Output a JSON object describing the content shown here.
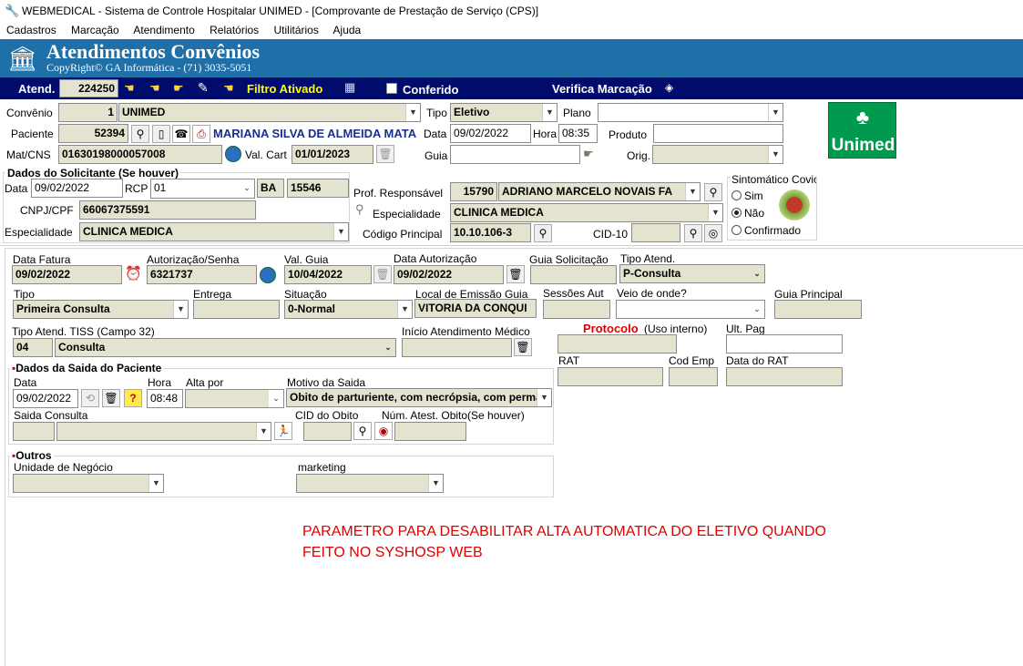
{
  "window": {
    "title": "WEBMEDICAL - Sistema de Controle Hospitalar UNIMED - [Comprovante de Prestação de Serviço  (CPS)]"
  },
  "menu": [
    "Cadastros",
    "Marcação",
    "Atendimento",
    "Relatórios",
    "Utilitários",
    "Ajuda"
  ],
  "banner": {
    "title": "Atendimentos Convênios",
    "subtitle": "CopyRight© GA Informática - (71) 3035-5051",
    "bg": "#1f6fa8"
  },
  "toolbar": {
    "atend_label": "Atend.",
    "atend_value": "224250",
    "filtro": "Filtro Ativado",
    "conferido": "Conferido",
    "verifica": "Verifica Marcação",
    "bg": "#000c6b",
    "filtro_color": "#ffff00"
  },
  "top": {
    "convenio_label": "Convênio",
    "convenio_code": "1",
    "convenio_name": "UNIMED",
    "tipo_label": "Tipo",
    "tipo_value": "Eletivo",
    "plano_label": "Plano",
    "plano_value": "",
    "paciente_label": "Paciente",
    "paciente_code": "52394",
    "paciente_name": "MARIANA SILVA DE ALMEIDA MATA",
    "data_label": "Data",
    "data_value": "09/02/2022",
    "hora_label": "Hora",
    "hora_value": "08:35",
    "produto_label": "Produto",
    "produto_value": "",
    "matcns_label": "Mat/CNS",
    "matcns_value": "01630198000057008",
    "valcart_label": "Val. Cart",
    "valcart_value": "01/01/2023",
    "guia_label": "Guia",
    "guia_value": "",
    "orig_label": "Orig.",
    "orig_value": "",
    "logo_text": "Unimed"
  },
  "solicitante": {
    "title": "Dados do Solicitante (Se houver)",
    "data_label": "Data",
    "data_value": "09/02/2022",
    "rcp_label": "RCP",
    "rcp_value": "01",
    "uf": "BA",
    "crm": "15546",
    "cnpj_label": "CNPJ/CPF",
    "cnpj_value": "66067375591",
    "esp_label": "Especialidade",
    "esp_value": "CLINICA MEDICA"
  },
  "profissional": {
    "label": "Prof. Responsável",
    "code": "15790",
    "name": "ADRIANO MARCELO NOVAIS FA",
    "esp_label": "Especialidade",
    "esp_value": "CLINICA MEDICA",
    "cod_label": "Código Principal",
    "cod_value": "10.10.106-3",
    "cid_label": "CID-10",
    "cid_value": ""
  },
  "sintomatico": {
    "label": "Sintomático Covic",
    "options": [
      "Sim",
      "Não",
      "Confirmado"
    ],
    "selected": "Não"
  },
  "fatura": {
    "data_fatura_label": "Data Fatura",
    "data_fatura": "09/02/2022",
    "aut_label": "Autorização/Senha",
    "aut_value": "6321737",
    "val_guia_label": "Val. Guia",
    "val_guia": "10/04/2022",
    "data_aut_label": "Data Autorização",
    "data_aut": "09/02/2022",
    "guia_sol_label": "Guia Solicitação",
    "guia_sol": "",
    "tipo_atend_label": "Tipo Atend.",
    "tipo_atend": "P-Consulta",
    "tipo_label": "Tipo",
    "tipo_value": "Primeira Consulta",
    "entrega_label": "Entrega",
    "entrega_value": "",
    "situacao_label": "Situação",
    "situacao_value": "0-Normal",
    "local_label": "Local de Emissão Guia",
    "local_value": "VITORIA DA CONQUI",
    "sessoes_label": "Sessões Aut",
    "sessoes_value": "",
    "veio_label": "Veio de onde?",
    "veio_value": "",
    "guia_principal_label": "Guia Principal",
    "guia_principal": "",
    "tiss_label": "Tipo Atend. TISS (Campo 32)",
    "tiss_code": "04",
    "tiss_value": "Consulta",
    "inicio_label": "Início Atendimento Médico",
    "inicio_value": "",
    "protocolo_label": "Protocolo",
    "protocolo_note": "(Uso interno)",
    "protocolo_value": "",
    "ult_pag_label": "Ult. Pag",
    "ult_pag": "",
    "rat_label": "RAT",
    "rat": "",
    "cod_emp_label": "Cod Emp",
    "cod_emp": "",
    "data_rat_label": "Data do RAT",
    "data_rat": ""
  },
  "saida": {
    "title": "Dados da Saida do Paciente",
    "data_label": "Data",
    "data_value": "09/02/2022",
    "hora_label": "Hora",
    "hora_value": "08:48",
    "alta_label": "Alta por",
    "alta_value": "",
    "motivo_label": "Motivo da Saida",
    "motivo_value": "Obito de parturiente, com necrópsia, com perma",
    "consulta_label": "Saida Consulta",
    "consulta_code": "",
    "consulta_value": "",
    "cid_obito_label": "CID do Obito",
    "cid_obito": "",
    "atest_label": "Núm. Atest. Obito(Se houver)",
    "atest_value": ""
  },
  "outros": {
    "title": "Outros",
    "unidade_label": "Unidade de Negócio",
    "unidade_value": "",
    "marketing_label": "marketing",
    "marketing_value": ""
  },
  "note": {
    "line1": "PARAMETRO PARA DESABILITAR ALTA AUTOMATICA DO ELETIVO QUANDO",
    "line2": "FEITO NO SYSHOSP WEB",
    "color": "#e00000"
  }
}
